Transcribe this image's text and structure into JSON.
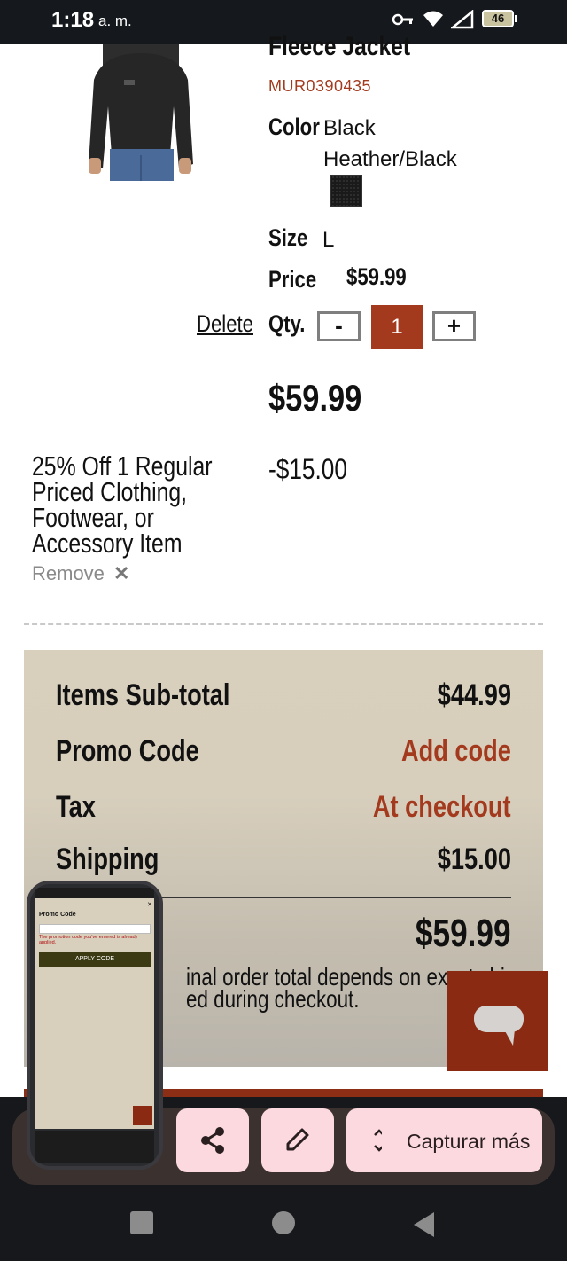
{
  "status_bar": {
    "time": "1:18",
    "ampm": "a. m.",
    "battery": "46"
  },
  "product": {
    "title_partial": "Fleece Jacket",
    "sku": "MUR0390435",
    "color_label": "Color",
    "color_value_line1": "Black",
    "color_value_line2": "Heather/Black",
    "size_label": "Size",
    "size_value": "L",
    "price_label": "Price",
    "price_value": "$59.99",
    "delete_label": "Delete",
    "qty_label": "Qty.",
    "qty_minus": "-",
    "qty_value": "1",
    "qty_plus": "+",
    "line_total": "$59.99"
  },
  "discount": {
    "description": "25% Off 1 Regular Priced Clothing, Footwear, or Accessory Item",
    "amount": "-$15.00",
    "remove_label": "Remove"
  },
  "summary": {
    "subtotal_label": "Items Sub-total",
    "subtotal_value": "$44.99",
    "promo_label": "Promo Code",
    "promo_action": "Add code",
    "tax_label": "Tax",
    "tax_value": "At checkout",
    "shipping_label": "Shipping",
    "shipping_value": "$15.00",
    "total_value": "$59.99",
    "note_line1": "inal order total depends on exact shi",
    "note_line2": "ed during checkout."
  },
  "screenshot_toolbar": {
    "capture_more_label": "Capturar más"
  },
  "thumbnail": {
    "promo_title": "Promo Code",
    "error_text": "The promotion code you've entered is already applied.",
    "apply_label": "APPLY CODE"
  },
  "colors": {
    "accent": "#a33a1e",
    "summary_bg": "#d8cfbd",
    "toolbar_button": "#fcd9df"
  }
}
